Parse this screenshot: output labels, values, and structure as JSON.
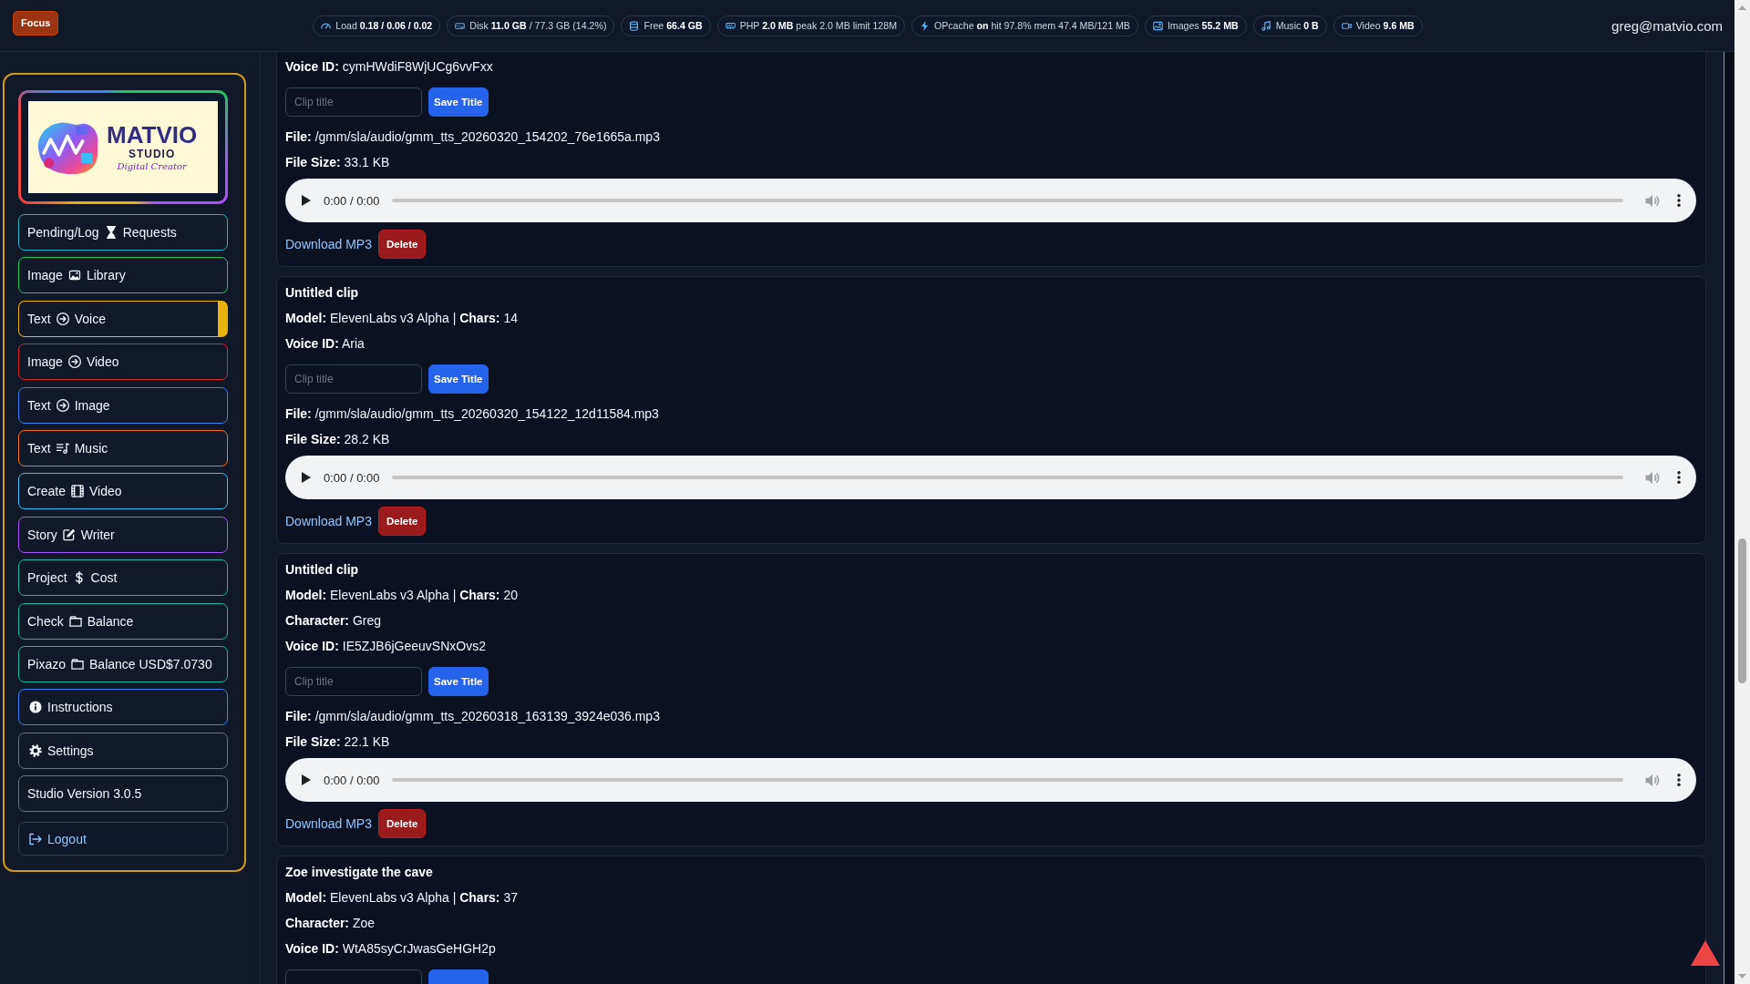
{
  "topbar": {
    "focus_button": "Focus",
    "stats": [
      "Load **0.18 / 0.06 / 0.02**",
      "Disk **11.0 GB** / 77.3 GB (14.2%)",
      "Free **66.4 GB**",
      "PHP **2.0 MB** peak 2.0 MB limit 128M",
      "OPcache **on** hit 97.8% mem 47.4 MB/121 MB",
      "Images **55.2 MB**",
      "Music **0 B**",
      "Video **9.6 MB**"
    ],
    "user": "greg@matvio.com"
  },
  "sidebar": {
    "logo": {
      "name": "MATVIO",
      "subtitle": "STUDIO",
      "tagline": "Digital Creator"
    },
    "items": [
      {
        "kind": "nav",
        "parts": [
          "Pending/Log",
          "Requests"
        ],
        "color": "#1fb6c9",
        "selected": false
      },
      {
        "kind": "nav",
        "parts": [
          "Image",
          "Library"
        ],
        "color": "#22c55e",
        "selected": false
      },
      {
        "kind": "nav",
        "parts": [
          "Text",
          "Voice"
        ],
        "color": "#eab308",
        "selected": true
      },
      {
        "kind": "nav",
        "parts": [
          "Image",
          "Video"
        ],
        "color": "#dc2626",
        "selected": false
      },
      {
        "kind": "nav",
        "parts": [
          "Text",
          "Image"
        ],
        "color": "#3b82f6",
        "selected": false
      },
      {
        "kind": "nav",
        "parts": [
          "Text",
          "Music"
        ],
        "color": "#f97316",
        "selected": false
      },
      {
        "kind": "nav",
        "parts": [
          "Create",
          "Video"
        ],
        "color": "#38bdf8",
        "selected": false
      },
      {
        "kind": "nav",
        "parts": [
          "Story",
          "Writer"
        ],
        "color": "#a855f7",
        "selected": false
      },
      {
        "kind": "nav",
        "parts": [
          "Project",
          "Cost"
        ],
        "color": "#14b8a6",
        "selected": false
      },
      {
        "kind": "nav",
        "parts": [
          "Check",
          "Balance"
        ],
        "color": "#14b8a6",
        "selected": false
      },
      {
        "kind": "nav",
        "parts": [
          "Pixazo",
          "Balance USD$7.0730"
        ],
        "color": "#14b8a6",
        "selected": false
      },
      {
        "kind": "nav",
        "parts": [
          "Instructions"
        ],
        "color": "#3b82f6",
        "selected": false
      },
      {
        "kind": "nav",
        "parts": [
          "Settings"
        ],
        "color": "#6b7280",
        "selected": false
      },
      {
        "kind": "label",
        "parts": [
          "Studio Version 3.0.5"
        ],
        "color": "#6b7280",
        "selected": false
      },
      {
        "kind": "logout",
        "parts": [
          "Logout"
        ],
        "color": "#374151",
        "selected": false
      }
    ]
  },
  "clips": [
    {
      "rows": [
        {
          "kind": "text",
          "text": "**Voice ID:** cymHWdiF8WjUCg6vvFxx"
        },
        {
          "kind": "form",
          "placeholder": "Clip title",
          "button": "Save Title"
        },
        {
          "kind": "text",
          "text": "**File:** /gmm/sla/audio/gmm_tts_20260320_154202_76e1665a.mp3"
        },
        {
          "kind": "text",
          "text": "**File Size:** 33.1 KB"
        },
        {
          "kind": "player",
          "time": "0:00 / 0:00"
        },
        {
          "kind": "actions",
          "link": "Download MP3",
          "button": "Delete"
        }
      ]
    },
    {
      "rows": [
        {
          "kind": "title",
          "text": "Untitled clip"
        },
        {
          "kind": "text",
          "text": "**Model:** ElevenLabs v3 Alpha | **Chars:** 14"
        },
        {
          "kind": "text",
          "text": "**Voice ID:** Aria"
        },
        {
          "kind": "form",
          "placeholder": "Clip title",
          "button": "Save Title"
        },
        {
          "kind": "text",
          "text": "**File:** /gmm/sla/audio/gmm_tts_20260320_154122_12d11584.mp3"
        },
        {
          "kind": "text",
          "text": "**File Size:** 28.2 KB"
        },
        {
          "kind": "player",
          "time": "0:00 / 0:00"
        },
        {
          "kind": "actions",
          "link": "Download MP3",
          "button": "Delete"
        }
      ]
    },
    {
      "rows": [
        {
          "kind": "title",
          "text": "Untitled clip"
        },
        {
          "kind": "text",
          "text": "**Model:** ElevenLabs v3 Alpha | **Chars:** 20"
        },
        {
          "kind": "text",
          "text": "**Character:** Greg"
        },
        {
          "kind": "text",
          "text": "**Voice ID:** IE5ZJB6jGeeuvSNxOvs2"
        },
        {
          "kind": "form",
          "placeholder": "Clip title",
          "button": "Save Title"
        },
        {
          "kind": "text",
          "text": "**File:** /gmm/sla/audio/gmm_tts_20260318_163139_3924e036.mp3"
        },
        {
          "kind": "text",
          "text": "**File Size:** 22.1 KB"
        },
        {
          "kind": "player",
          "time": "0:00 / 0:00"
        },
        {
          "kind": "actions",
          "link": "Download MP3",
          "button": "Delete"
        }
      ]
    },
    {
      "rows": [
        {
          "kind": "title",
          "text": "Zoe investigate the cave"
        },
        {
          "kind": "text",
          "text": "**Model:** ElevenLabs v3 Alpha | **Chars:** 37"
        },
        {
          "kind": "text",
          "text": "**Character:** Zoe"
        },
        {
          "kind": "text",
          "text": "**Voice ID:** WtA85syCrJwasGeHGH2p"
        },
        {
          "kind": "form"
        }
      ]
    }
  ]
}
